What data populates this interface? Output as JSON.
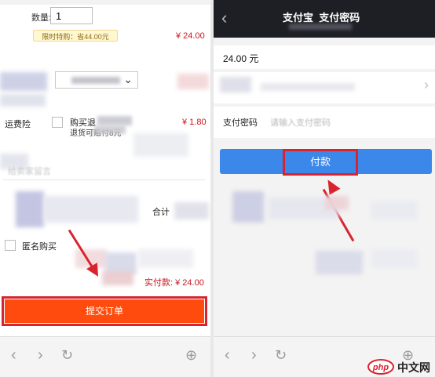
{
  "order": {
    "qty_label": "数量:",
    "qty_value": "1",
    "promo_badge": "限时特购：省44.00元",
    "item_price": "¥ 24.00",
    "shipping_ins_label": "运费险",
    "shipping_ins_desc_1": "购买退",
    "shipping_ins_desc_2": "退货可赔付8元",
    "shipping_ins_price": "¥ 1.80",
    "memo_placeholder": "给卖家留言",
    "total_label": "合计",
    "anonymous_label": "匿名购买",
    "actual_pay": "实付款: ¥ 24.00",
    "submit_label": "提交订单"
  },
  "alipay": {
    "title": "支付宝  支付密码",
    "amount": "24.00 元",
    "pwd_label": "支付密码",
    "pwd_placeholder": "请输入支付密码",
    "pay_label": "付款"
  },
  "nav": {
    "back": "‹",
    "forward": "›",
    "refresh": "↻",
    "add": "⊕"
  },
  "watermark": {
    "logo_text": "php",
    "site_text": "中文网"
  },
  "colors": {
    "submit_orange": "#ff4c0e",
    "pay_blue": "#3b87ea",
    "highlight_red": "#d9232e",
    "price_red": "#c8151d",
    "alipay_header": "#1e1f24"
  }
}
